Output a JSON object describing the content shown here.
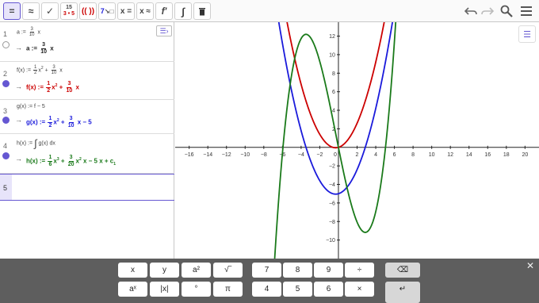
{
  "toolbar": {
    "buttons": [
      "=",
      "≈",
      "✓",
      "15",
      "3 • 5",
      "(( ))",
      "7",
      "x =",
      "x ≈",
      "f'",
      "∫",
      "🗑"
    ],
    "icons": [
      "undo-icon",
      "redo-icon",
      "search-icon",
      "menu-icon"
    ]
  },
  "algebra": {
    "rows": [
      {
        "num": "1",
        "input": "a := ",
        "input_frac": {
          "num": "3",
          "den": "10"
        },
        "input_tail": " x",
        "out_name": "a := ",
        "out_frac": {
          "num": "3",
          "den": "10"
        },
        "out_tail": " x",
        "color": "#222222"
      },
      {
        "num": "2",
        "input": "f(x) := ",
        "color": "#cc0000"
      },
      {
        "num": "3",
        "input": "g(x) := f − 5",
        "color": "#1a1adb"
      },
      {
        "num": "4",
        "input": "h(x) := ",
        "color": "#1a7a1a"
      },
      {
        "num": "5"
      }
    ],
    "row2_out": "f(x) := ",
    "row3_out": "g(x) := ",
    "row3_tail": " x − 5",
    "row4_input_tail": " g(x) dx",
    "row4_out": "h(x) := ",
    "row4_tail": " x − 5 x + c",
    "row4_sub": "1",
    "fracs": {
      "half": {
        "num": "1",
        "den": "2"
      },
      "three_tenths": {
        "num": "3",
        "den": "10"
      },
      "sixth": {
        "num": "1",
        "den": "6"
      },
      "three_twentieths": {
        "num": "3",
        "den": "20"
      }
    },
    "x2": "x",
    "x3": "x",
    "exp2": "2",
    "exp3": "3",
    "plus": " + ",
    "x": " x",
    "integral": "∫"
  },
  "graph": {
    "x_ticks": [
      "−16",
      "−14",
      "−12",
      "−10",
      "−8",
      "−6",
      "−4",
      "−2",
      "0",
      "2",
      "4",
      "6",
      "8",
      "10",
      "12",
      "14",
      "16",
      "18",
      "20"
    ],
    "y_ticks": [
      "12",
      "10",
      "8",
      "6",
      "4",
      "2",
      "−2",
      "−4",
      "−6",
      "−8",
      "−10"
    ],
    "colors": {
      "f": "#cc0000",
      "g": "#1a1adb",
      "h": "#1a7a1a"
    },
    "x_range": [
      -17.5,
      21.5
    ],
    "y_range": [
      -12.0,
      13.5
    ]
  },
  "keyboard": {
    "row1": [
      "x",
      "y",
      "a²",
      "√‾",
      "7",
      "8",
      "9",
      "÷"
    ],
    "row2": [
      "aˣ",
      "|x|",
      "°",
      "π",
      "4",
      "5",
      "6",
      "×"
    ],
    "backspace": "⌫",
    "enter": "↵",
    "close": "✕"
  }
}
